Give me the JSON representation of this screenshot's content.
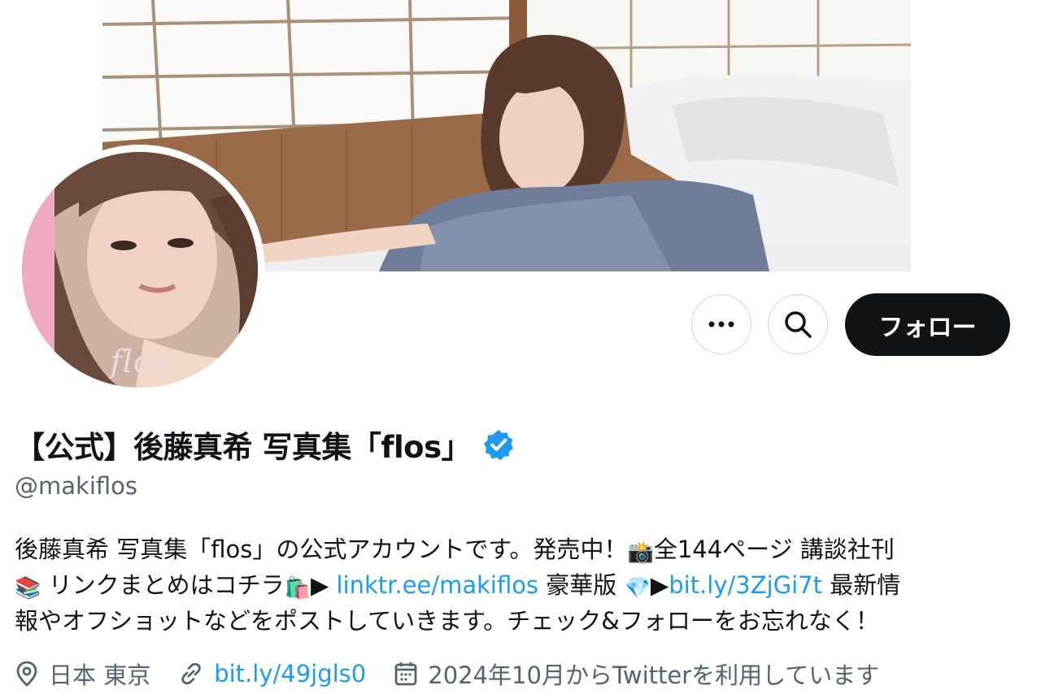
{
  "profile": {
    "display_name": "【公式】後藤真希 写真集「flos」",
    "handle": "@makiflos",
    "avatar_logo_text": "flos"
  },
  "actions": {
    "more_icon": "more-horizontal-icon",
    "search_icon": "search-icon",
    "follow_label": "フォロー"
  },
  "bio": {
    "line1_text": "後藤真希 写真集「flos」の公式アカウントです。発売中！",
    "line1_emoji": "📸",
    "line1_text2": "全144ページ 講談社刊",
    "line2_emoji1": "📚",
    "line2_text1": " リンクまとめはコチラ",
    "line2_emoji2": "🛍️",
    "line2_arrow": "▶",
    "line2_link1": "linktr.ee/makiflos",
    "line2_text2": " 豪華版 ",
    "line2_emoji3": "💎",
    "line2_arrow2": "▶",
    "line2_link2": "bit.ly/3ZjGi7t",
    "line2_text3": " 最新情",
    "line3_text": "報やオフショットなどをポストしていきます。チェック&フォローをお忘れなく！"
  },
  "meta": {
    "location": "日本 東京",
    "website": "bit.ly/49jgls0",
    "joined": "2024年10月からTwitterを利用しています"
  },
  "colors": {
    "link": "#1d9bf0",
    "follow_bg": "#0f1419",
    "secondary_text": "#536471",
    "verified": "#1d9bf0"
  }
}
